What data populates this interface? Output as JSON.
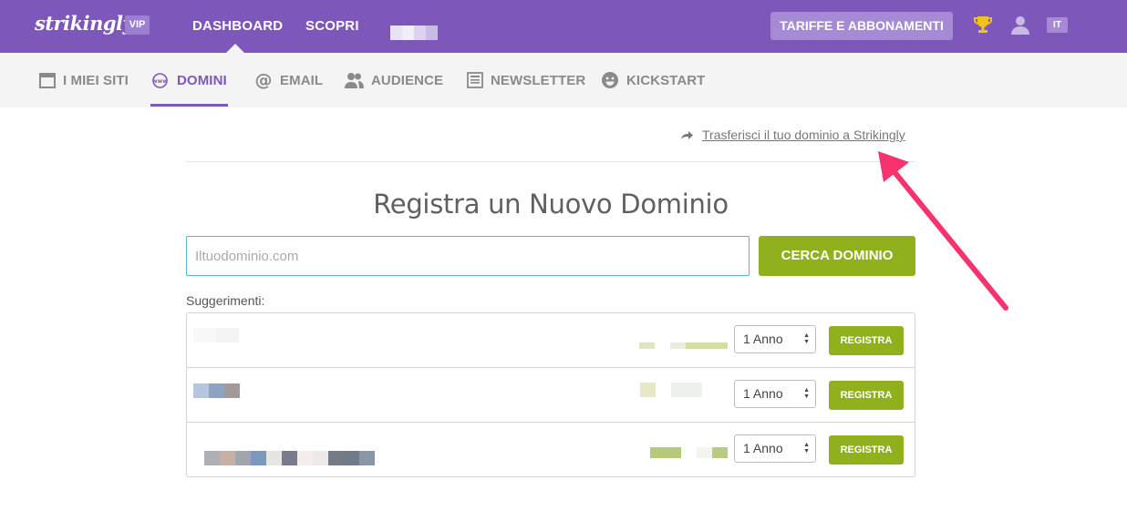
{
  "header": {
    "logo": "strikingly",
    "vip_badge": "VIP",
    "nav": [
      "DASHBOARD",
      "SCOPRI"
    ],
    "plans_button": "TARIFFE E ABBONAMENTI",
    "lang": "IT",
    "icons": [
      "trophy-icon",
      "user-icon"
    ],
    "accent": "#7e57bb"
  },
  "subnav": {
    "items": [
      {
        "label": "I MIEI SITI",
        "icon": "browser-window-icon"
      },
      {
        "label": "DOMINI",
        "icon": "www-globe-icon",
        "active": true
      },
      {
        "label": "EMAIL",
        "icon": "at-icon"
      },
      {
        "label": "AUDIENCE",
        "icon": "users-icon"
      },
      {
        "label": "NEWSLETTER",
        "icon": "newsletter-icon"
      },
      {
        "label": "KICKSTART",
        "icon": "smiley-icon"
      }
    ]
  },
  "main": {
    "transfer_link": "Trasferisci il tuo dominio a Strikingly",
    "title": "Registra un Nuovo Dominio",
    "search": {
      "placeholder": "Iltuodominio.com",
      "value": ""
    },
    "search_button": "CERCA DOMINIO",
    "suggestions_label": "Suggerimenti:",
    "suggestions": [
      {
        "duration": "1 Anno",
        "button": "REGISTRA"
      },
      {
        "duration": "1 Anno",
        "button": "REGISTRA"
      },
      {
        "duration": "1 Anno",
        "button": "REGISTRA"
      }
    ],
    "button_color": "#90b01e"
  }
}
